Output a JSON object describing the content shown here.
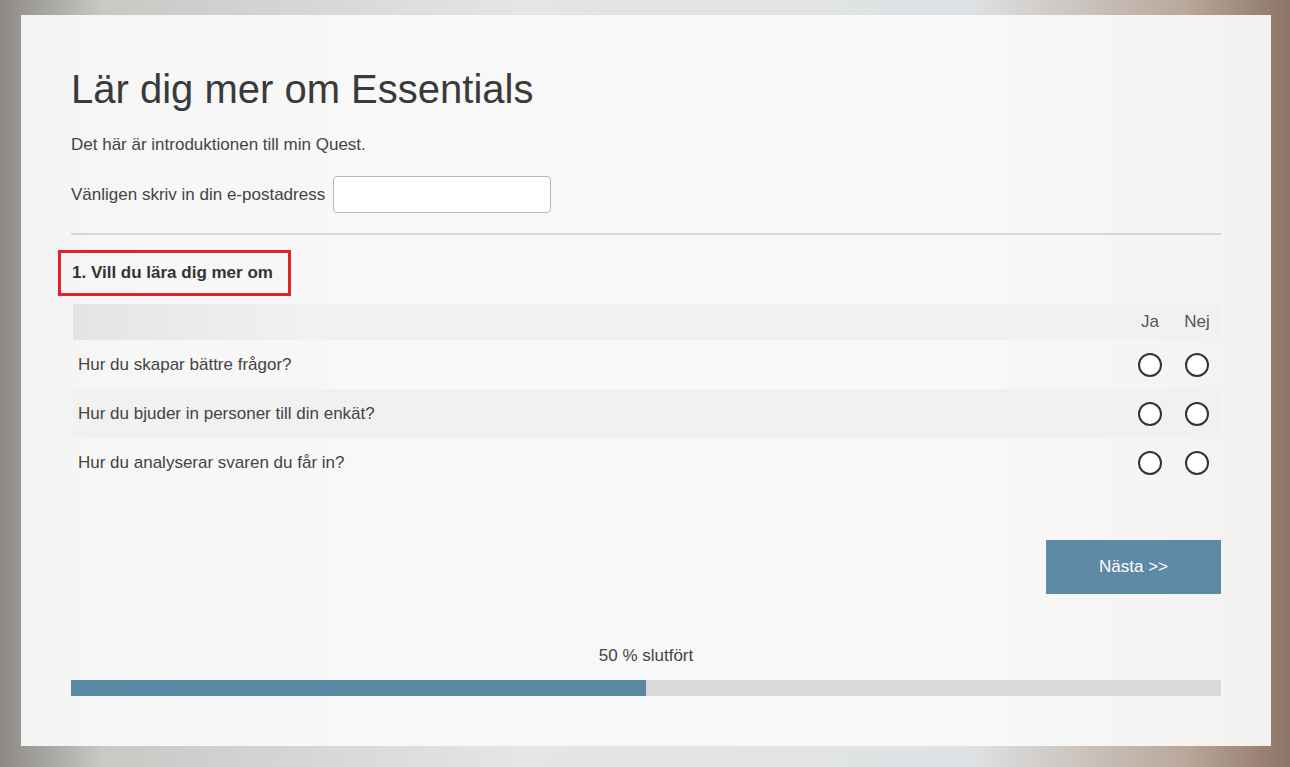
{
  "page": {
    "title": "Lär dig mer om Essentials",
    "intro": "Det här är introduktionen till min Quest."
  },
  "email": {
    "label": "Vänligen skriv in din e-postadress",
    "value": ""
  },
  "question": {
    "title": "1. Vill du lära dig mer om",
    "highlighted": true,
    "columns": [
      "Ja",
      "Nej"
    ],
    "rows": [
      {
        "label": "Hur du skapar bättre frågor?",
        "choices": [
          {
            "selected": false
          },
          {
            "selected": false
          }
        ]
      },
      {
        "label": "Hur du bjuder in personer till din enkät?",
        "choices": [
          {
            "selected": false
          },
          {
            "selected": false
          }
        ]
      },
      {
        "label": "Hur du analyserar svaren du får in?",
        "choices": [
          {
            "selected": false
          },
          {
            "selected": false
          }
        ]
      }
    ]
  },
  "next_button": {
    "label": "Nästa >>"
  },
  "progress": {
    "label": "50 % slutfört",
    "level": 0.5
  }
}
